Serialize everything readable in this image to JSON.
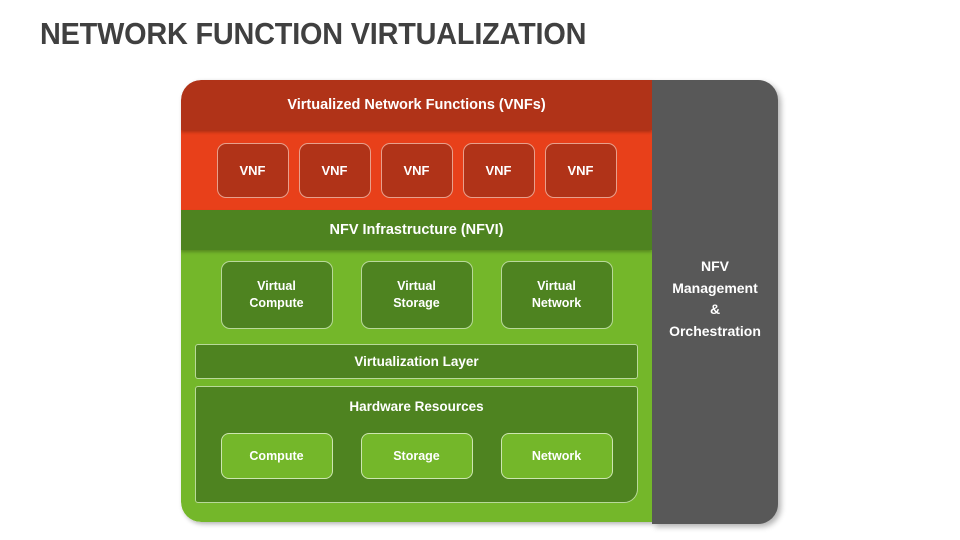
{
  "page": {
    "title": "NETWORK FUNCTION VIRTUALIZATION"
  },
  "colors": {
    "title_text": "#404040",
    "vnf_header_bg": "#b03318",
    "vnf_body_bg": "#e8401a",
    "nfvi_header_bg": "#4e8320",
    "nfvi_body_bg": "#74b72a",
    "panel_dark_green": "#4e8320",
    "panel_light_green": "#74b72a",
    "mano_bg": "#585858",
    "box_text": "#ffffff"
  },
  "diagram": {
    "vnf_layer": {
      "header": "Virtualized Network Functions (VNFs)",
      "boxes": [
        {
          "label": "VNF"
        },
        {
          "label": "VNF"
        },
        {
          "label": "VNF"
        },
        {
          "label": "VNF"
        },
        {
          "label": "VNF"
        }
      ]
    },
    "nfvi_layer": {
      "header": "NFV Infrastructure (NFVI)",
      "virtual_resources": [
        {
          "line1": "Virtual",
          "line2": "Compute"
        },
        {
          "line1": "Virtual",
          "line2": "Storage"
        },
        {
          "line1": "Virtual",
          "line2": "Network"
        }
      ],
      "virtualization_layer": {
        "label": "Virtualization Layer"
      },
      "hardware_resources": {
        "title": "Hardware Resources",
        "boxes": [
          {
            "label": "Compute"
          },
          {
            "label": "Storage"
          },
          {
            "label": "Network"
          }
        ]
      }
    },
    "mano_panel": {
      "lines": [
        "NFV",
        "Management",
        "&",
        "Orchestration"
      ]
    }
  }
}
